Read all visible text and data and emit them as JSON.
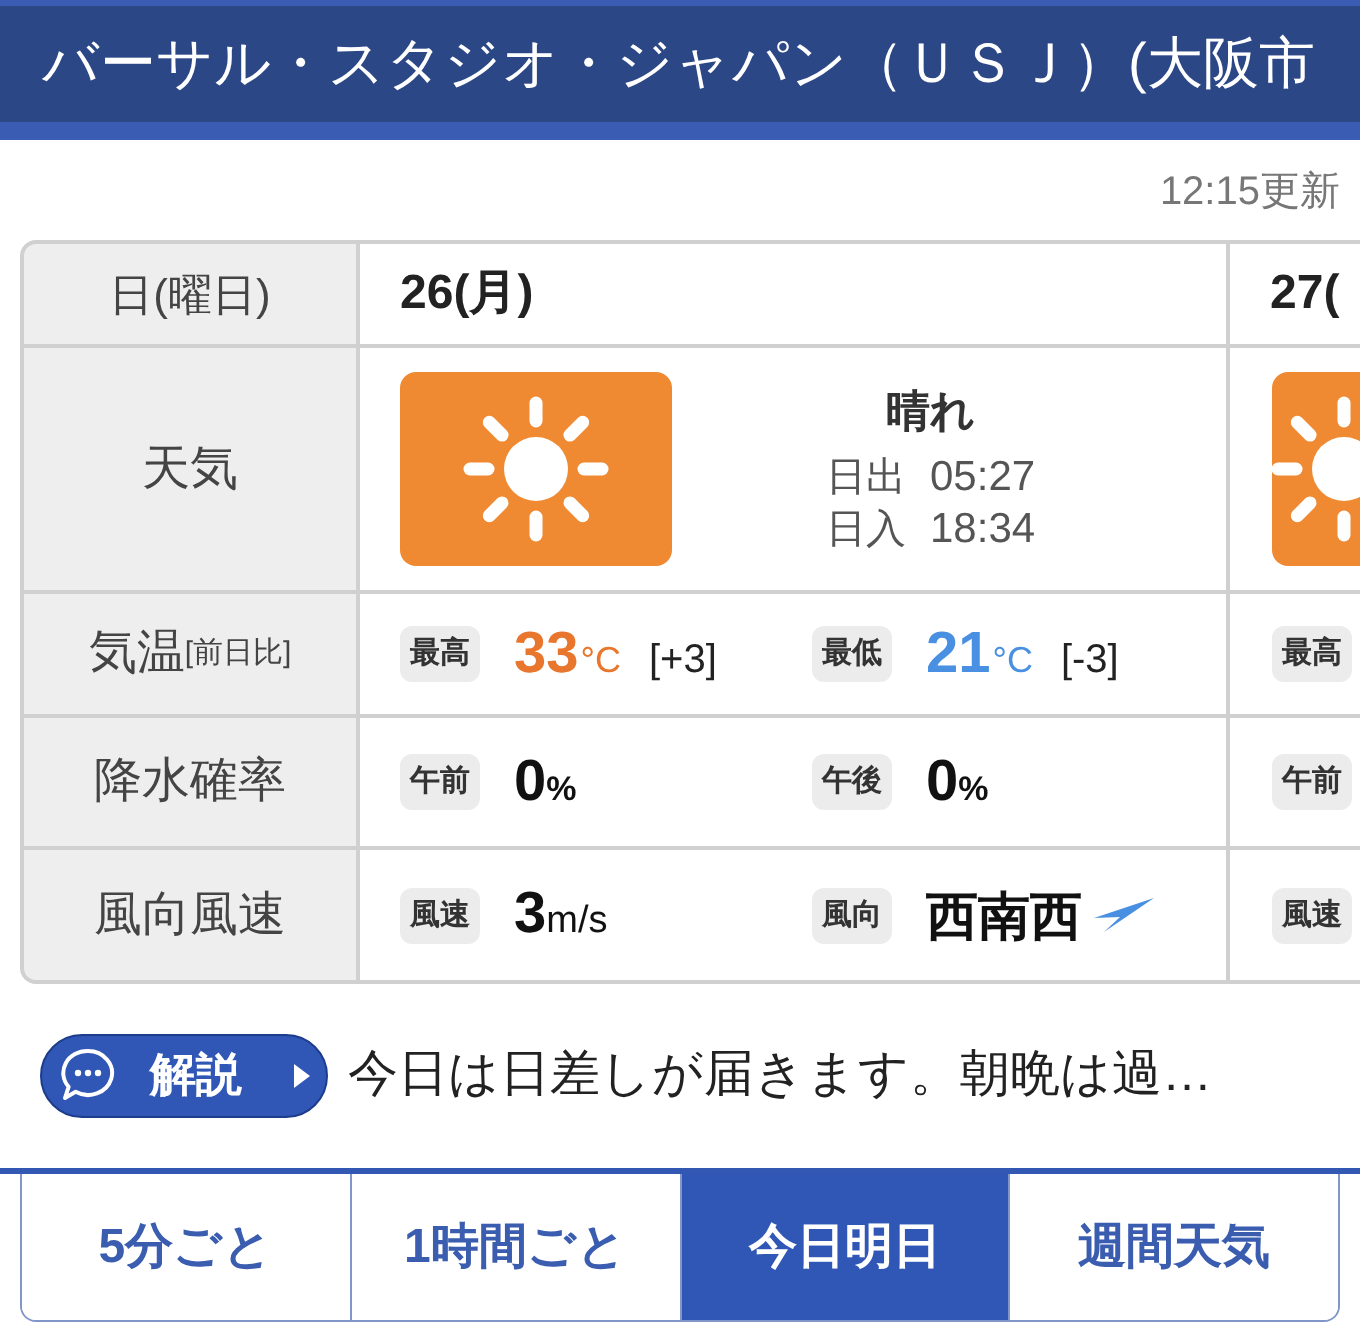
{
  "header": {
    "title": "バーサル・スタジオ・ジャパン（ＵＳＪ）(大阪市"
  },
  "updated": "12:15更新",
  "table": {
    "row_labels": [
      {
        "text": "日(曜日)"
      },
      {
        "text": "天気"
      },
      {
        "text": "気温",
        "note": "[前日比]"
      },
      {
        "text": "降水確率"
      },
      {
        "text": "風向風速"
      }
    ],
    "days": [
      {
        "date": "26(月)",
        "weather": {
          "kind": "sunny",
          "label": "晴れ",
          "sunrise_label": "日出",
          "sunrise": "05:27",
          "sunset_label": "日入",
          "sunset": "18:34"
        },
        "temperature": [
          {
            "tag": "最高",
            "value": "33",
            "unit": "°C",
            "diff": "[+3]",
            "color": "#e8762d"
          },
          {
            "tag": "最低",
            "value": "21",
            "unit": "°C",
            "diff": "[-3]",
            "color": "#4a90e2"
          }
        ],
        "precipitation": [
          {
            "tag": "午前",
            "value": "0",
            "unit": "%"
          },
          {
            "tag": "午後",
            "value": "0",
            "unit": "%"
          }
        ],
        "wind": [
          {
            "kind": "speed",
            "tag": "風速",
            "value": "3",
            "unit": "m/s"
          },
          {
            "kind": "direction",
            "tag": "風向",
            "value": "西南西"
          }
        ]
      },
      {
        "date": "27(",
        "weather": {
          "kind": "sunny"
        },
        "temperature": [
          {
            "tag": "最高"
          }
        ],
        "precipitation": [
          {
            "tag": "午前"
          }
        ],
        "wind": [
          {
            "kind": "speed",
            "tag": "風速"
          }
        ]
      }
    ]
  },
  "commentary": {
    "button": "解説",
    "text": "今日は日差しが届きます。朝晩は過…"
  },
  "tabs": [
    {
      "label": "5分ごと",
      "selected": false
    },
    {
      "label": "1時間ごと",
      "selected": false
    },
    {
      "label": "今日明日",
      "selected": true
    },
    {
      "label": "週間天気",
      "selected": false
    }
  ]
}
